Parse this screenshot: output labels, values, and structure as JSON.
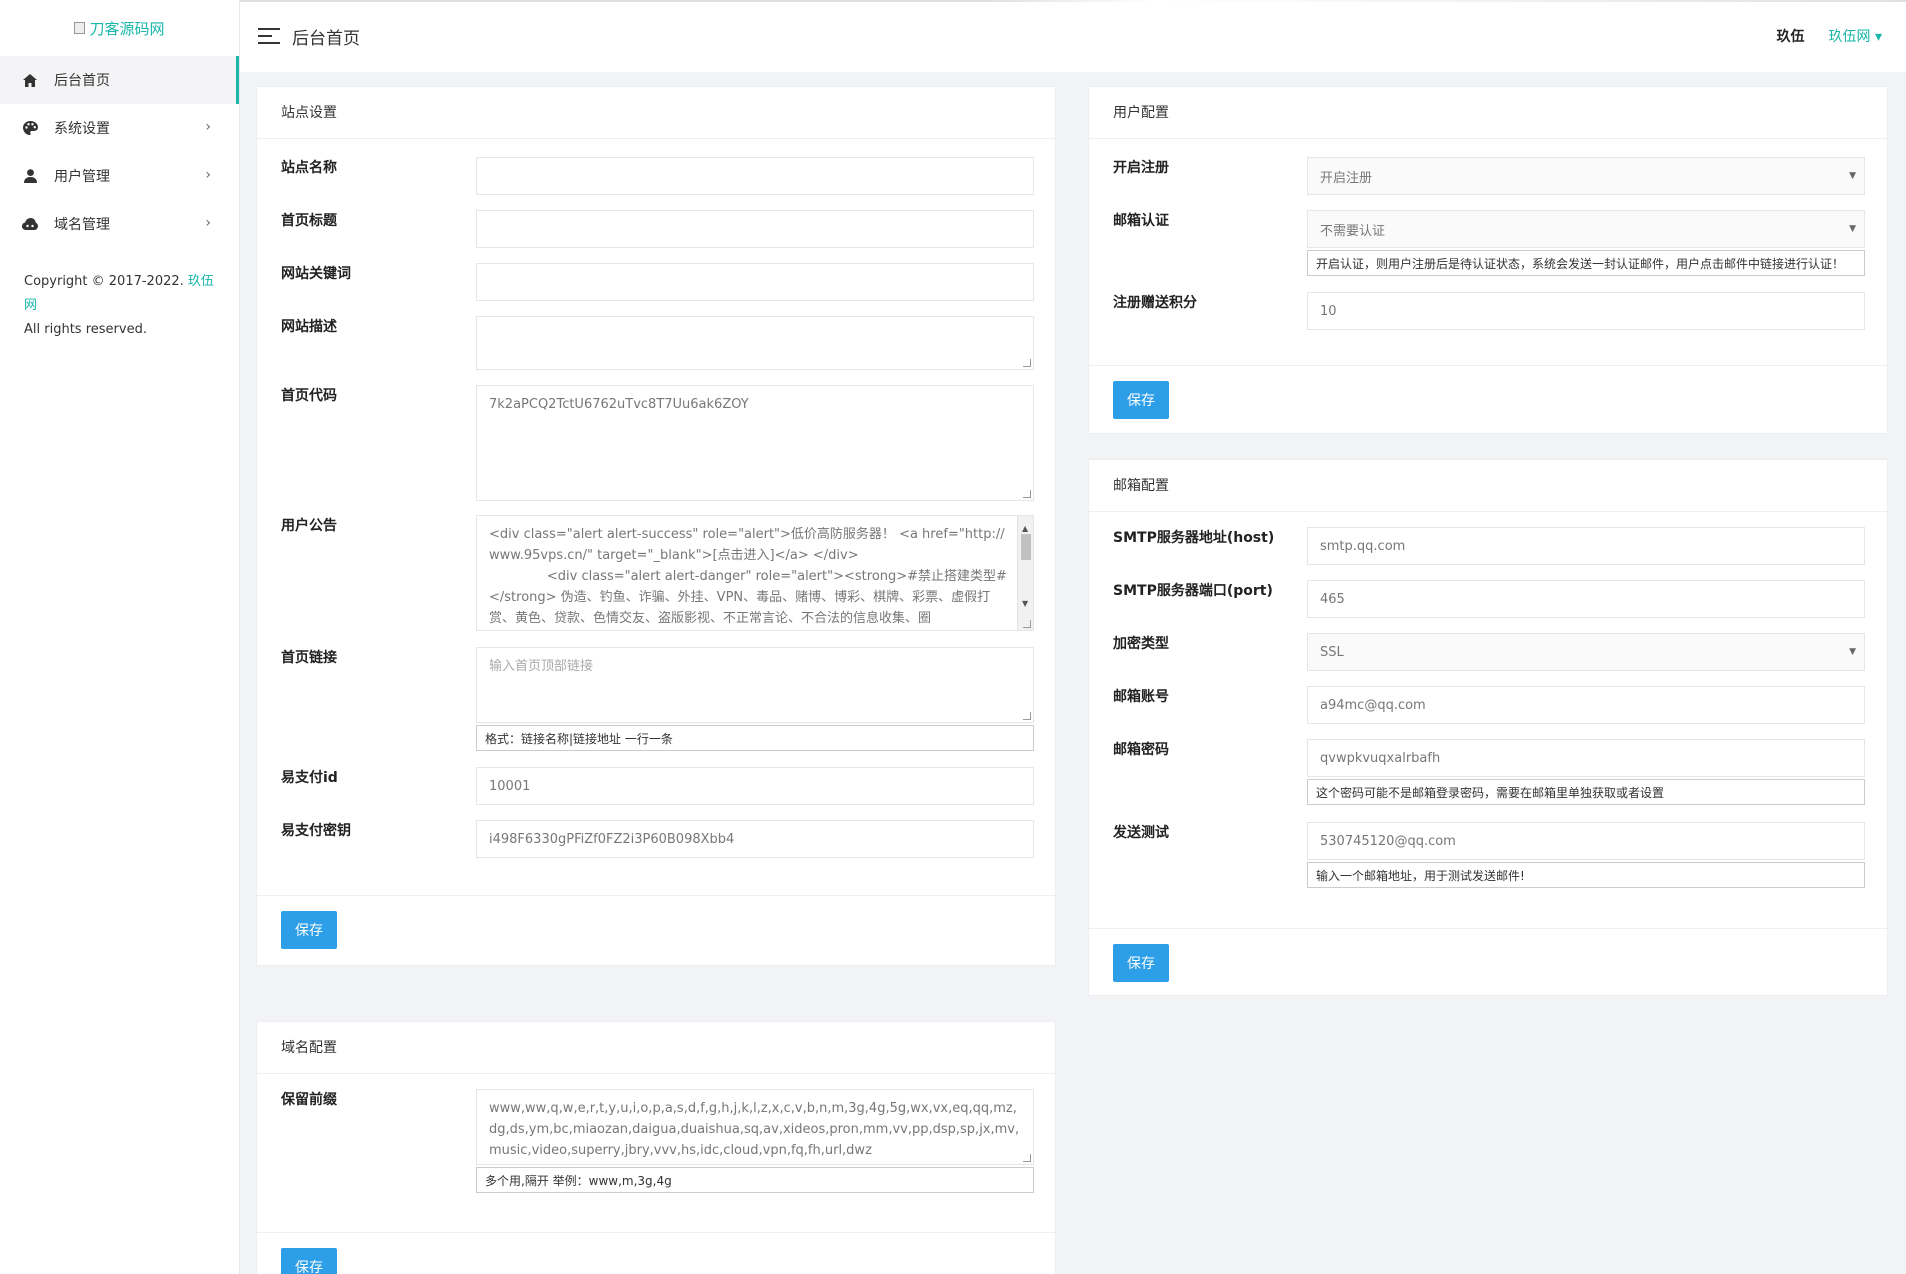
{
  "sidebar": {
    "brand_text": "刀客源码网",
    "items": [
      {
        "label": "后台首页"
      },
      {
        "label": "系统设置"
      },
      {
        "label": "用户管理"
      },
      {
        "label": "域名管理"
      }
    ],
    "copyright_prefix": "Copyright © 2017-2022.",
    "copyright_link": "玖伍网",
    "rights": "All rights reserved."
  },
  "header": {
    "title": "后台首页",
    "user_name": "玖伍",
    "site_menu": "玖伍网 ▾"
  },
  "site_settings": {
    "title": "站点设置",
    "site_name_label": "站点名称",
    "site_name_value": "",
    "home_title_label": "首页标题",
    "home_title_value": "",
    "keywords_label": "网站关键词",
    "keywords_value": "",
    "description_label": "网站描述",
    "description_value": "",
    "home_code_label": "首页代码",
    "home_code_value": "7k2aPCQ2TctU6762uTvc8T7Uu6ak6ZOY",
    "notice_label": "用户公告",
    "notice_value": "<div class=\"alert alert-success\" role=\"alert\">低价高防服务器！ <a href=\"http://www.95vps.cn/\" target=\"_blank\">[点击进入]</a> </div>\n              <div class=\"alert alert-danger\" role=\"alert\"><strong>#禁止搭建类型#</strong> 伪造、钓鱼、诈骗、外挂、VPN、毒品、赌博、博彩、棋牌、彩票、虚假打赏、黄色、贷款、色情交友、盗版影视、不正常言论、不合法的信息收集、圈",
    "home_links_label": "首页链接",
    "home_links_placeholder": "输入首页顶部链接",
    "home_links_hint": "格式：链接名称|链接地址 一行一条",
    "epay_id_label": "易支付id",
    "epay_id_value": "10001",
    "epay_key_label": "易支付密钥",
    "epay_key_value": "i498F6330gPFiZf0FZ2i3P60B098Xbb4",
    "save_label": "保存"
  },
  "domain_config": {
    "title": "域名配置",
    "reserved_label": "保留前缀",
    "reserved_value": "www,ww,q,w,e,r,t,y,u,i,o,p,a,s,d,f,g,h,j,k,l,z,x,c,v,b,n,m,3g,4g,5g,wx,vx,eq,qq,mz,dg,ds,ym,bc,miaozan,daigua,duaishua,sq,av,xideos,pron,mm,vv,pp,dsp,sp,jx,mv,music,video,superry,jbry,vvv,hs,idc,cloud,vpn,fq,fh,url,dwz",
    "reserved_hint": "多个用,隔开 举例：www,m,3g,4g",
    "save_label": "保存"
  },
  "user_config": {
    "title": "用户配置",
    "register_label": "开启注册",
    "register_value": "开启注册",
    "email_verify_label": "邮箱认证",
    "email_verify_value": "不需要认证",
    "email_verify_hint": "开启认证，则用户注册后是待认证状态，系统会发送一封认证邮件，用户点击邮件中链接进行认证！",
    "bonus_label": "注册赠送积分",
    "bonus_value": "10",
    "save_label": "保存"
  },
  "mail_config": {
    "title": "邮箱配置",
    "host_label": "SMTP服务器地址(host)",
    "host_value": "smtp.qq.com",
    "port_label": "SMTP服务器端口(port)",
    "port_value": "465",
    "encrypt_label": "加密类型",
    "encrypt_value": "SSL",
    "account_label": "邮箱账号",
    "account_value": "a94mc@qq.com",
    "password_label": "邮箱密码",
    "password_value": "qvwpkvuqxalrbafh",
    "password_hint": "这个密码可能不是邮箱登录密码，需要在邮箱里单独获取或者设置",
    "test_label": "发送测试",
    "test_value": "530745120@qq.com",
    "test_hint": "输入一个邮箱地址，用于测试发送邮件!",
    "save_label": "保存"
  }
}
